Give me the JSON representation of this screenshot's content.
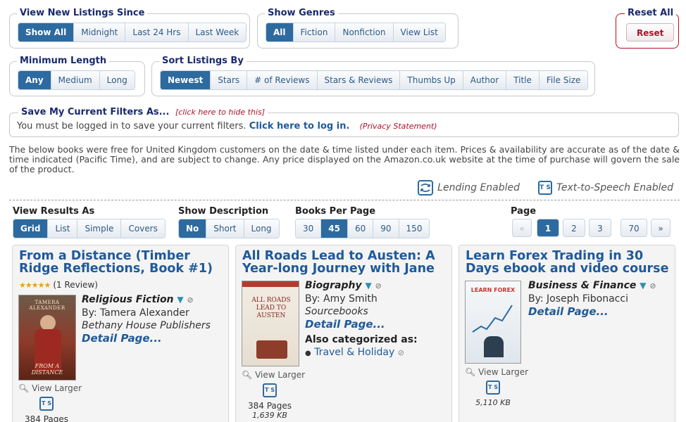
{
  "filters": {
    "since": {
      "legend": "View New Listings Since",
      "options": [
        "Show All",
        "Midnight",
        "Last 24 Hrs",
        "Last Week"
      ],
      "active": 0
    },
    "genres": {
      "legend": "Show Genres",
      "options": [
        "All",
        "Fiction",
        "Nonfiction",
        "View List"
      ],
      "active": 0
    },
    "reset": {
      "legend": "Reset All",
      "button": "Reset"
    },
    "length": {
      "legend": "Minimum Length",
      "options": [
        "Any",
        "Medium",
        "Long"
      ],
      "active": 0
    },
    "sort": {
      "legend": "Sort Listings By",
      "options": [
        "Newest",
        "Stars",
        "# of Reviews",
        "Stars & Reviews",
        "Thumbs Up",
        "Author",
        "Title",
        "File Size"
      ],
      "active": 0
    }
  },
  "save": {
    "legend": "Save My Current Filters As...",
    "hide_link": "[click here to hide this]",
    "message": "You must be logged in to save your current filters.",
    "login_link": "Click here to log in.",
    "privacy_link": "(Privacy Statement)"
  },
  "disclaimer": "The below books were free for United Kingdom customers on the date & time listed under each item. Prices & availability are accurate as of the date & time indicated (Pacific Time), and are subject to change. Any price displayed on the Amazon.co.uk website at the time of purchase will govern the sale of the product.",
  "features": {
    "lending": "Lending Enabled",
    "tts": "Text-to-Speech Enabled",
    "tts_icon_text": "T S"
  },
  "view": {
    "results_label": "View Results As",
    "results_options": [
      "Grid",
      "List",
      "Simple",
      "Covers"
    ],
    "description_label": "Show Description",
    "description_options": [
      "No",
      "Short",
      "Long"
    ],
    "per_page_label": "Books Per Page",
    "per_page_options": [
      "30",
      "45",
      "60",
      "90",
      "150"
    ],
    "page_label": "Page",
    "pages": [
      "«",
      "1",
      "2",
      "3",
      "70",
      "»"
    ]
  },
  "books": [
    {
      "title": "From a Distance (Timber Ridge Reflections, Book #1)",
      "stars_glyph": "★★★★★",
      "reviews": "(1 Review)",
      "category": "Religious Fiction",
      "author": "By: Tamera Alexander",
      "publisher": "Bethany House Publishers",
      "detail": "Detail Page...",
      "view_larger": "View Larger",
      "pages": "384 Pages",
      "cover_title": "TAMERA ALEXANDER",
      "cover_sub": "FROM A DISTANCE"
    },
    {
      "title": "All Roads Lead to Austen: A Year-long Journey with Jane",
      "category": "Biography",
      "author": "By: Amy Smith",
      "publisher": "Sourcebooks",
      "detail": "Detail Page...",
      "also_label": "Also categorized as:",
      "also_items": [
        "Travel & Holiday"
      ],
      "view_larger": "View Larger",
      "pages": "384 Pages",
      "size": "1,639 KB",
      "cover_title": "ALL ROADS LEAD TO AUSTEN"
    },
    {
      "title": "Learn Forex Trading in 30 Days ebook and video course",
      "category": "Business & Finance",
      "author": "By: Joseph Fibonacci",
      "detail": "Detail Page...",
      "view_larger": "View Larger",
      "size": "5,110 KB",
      "cover_title": "LEARN FOREX"
    }
  ]
}
